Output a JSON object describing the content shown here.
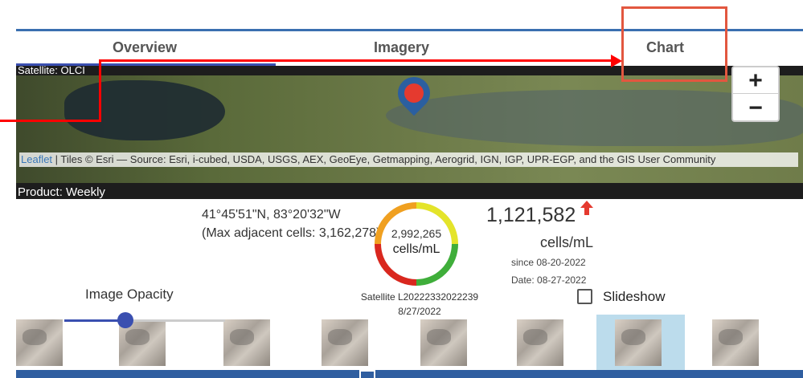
{
  "tabs": [
    {
      "label": "Overview"
    },
    {
      "label": "Imagery"
    },
    {
      "label": "Chart"
    }
  ],
  "map": {
    "satellite_label": "Satellite: OLCI",
    "zoom_in": "+",
    "zoom_out": "−",
    "attribution_link": "Leaflet",
    "attribution_text": " | Tiles © Esri — Source: Esri, i-cubed, USDA, USGS, AEX, GeoEye, Getmapping, Aerogrid, IGN, IGP, UPR-EGP, and the GIS User Community"
  },
  "product_label": "Product: Weekly",
  "location": {
    "coordinates": "41°45'51\"N, 83°20'32\"W",
    "max_adjacent": "(Max adjacent cells: 3,162,278)"
  },
  "gauge": {
    "value": "2,992,265",
    "unit": "cells/mL",
    "fraction": 0.75,
    "colors": [
      "#d9271e",
      "#f0a020",
      "#e4e42a",
      "#3fae3a"
    ]
  },
  "satellite_image": {
    "line1": "Satellite L20222332022239",
    "line2": "8/27/2022"
  },
  "stats": {
    "count": "1,121,582",
    "unit": "cells/mL",
    "since": "since 08-20-2022",
    "date": "Date: 08-27-2022",
    "trend_color": "#e53a2f"
  },
  "controls": {
    "opacity_label": "Image Opacity",
    "opacity_value": 0.38,
    "slideshow_label": "Slideshow"
  },
  "accent_color": "#3a4fb0",
  "annotation_color": "#ff0000"
}
